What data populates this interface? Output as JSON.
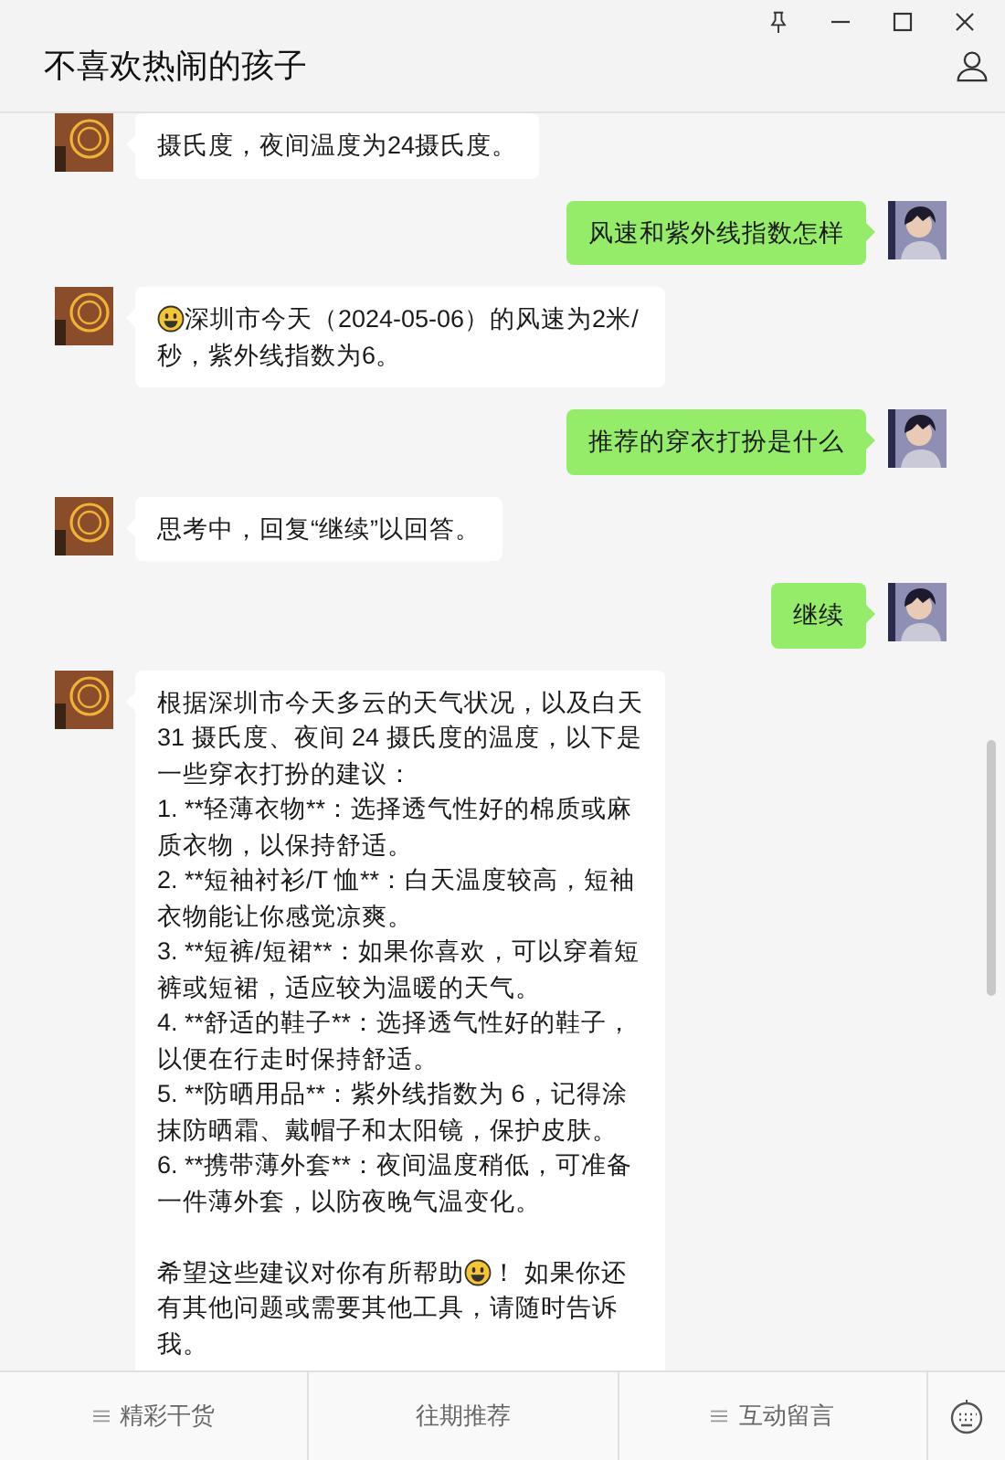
{
  "window": {
    "title": "不喜欢热闹的孩子"
  },
  "messages": [
    {
      "kind": "incoming",
      "paragraphs": [
        {
          "kind": "text",
          "segments": [
            {
              "kind": "text",
              "text": "摄氏度，夜间温度为24摄氏度。"
            }
          ]
        }
      ]
    },
    {
      "kind": "outgoing",
      "paragraphs": [
        {
          "kind": "text",
          "segments": [
            {
              "kind": "text",
              "text": "风速和紫外线指数怎样"
            }
          ]
        }
      ]
    },
    {
      "kind": "incoming",
      "paragraphs": [
        {
          "kind": "text",
          "segments": [
            {
              "kind": "emoji"
            },
            {
              "kind": "text",
              "text": "深圳市今天（2024-05-06）的风速为2米/秒，紫外线指数为6。"
            }
          ]
        }
      ]
    },
    {
      "kind": "outgoing",
      "paragraphs": [
        {
          "kind": "text",
          "segments": [
            {
              "kind": "text",
              "text": "推荐的穿衣打扮是什么"
            }
          ]
        }
      ]
    },
    {
      "kind": "incoming",
      "paragraphs": [
        {
          "kind": "text",
          "segments": [
            {
              "kind": "text",
              "text": "思考中，回复“继续”以回答。"
            }
          ]
        }
      ]
    },
    {
      "kind": "outgoing",
      "paragraphs": [
        {
          "kind": "text",
          "segments": [
            {
              "kind": "text",
              "text": "继续"
            }
          ]
        }
      ]
    },
    {
      "kind": "incoming",
      "paragraphs": [
        {
          "kind": "text",
          "segments": [
            {
              "kind": "text",
              "text": "根据深圳市今天多云的天气状况，以及白天 31 摄氏度、夜间 24 摄氏度的温度，以下是一些穿衣打扮的建议："
            }
          ]
        },
        {
          "kind": "text",
          "segments": [
            {
              "kind": "text",
              "text": "1. **轻薄衣物**：选择透气性好的棉质或麻质衣物，以保持舒适。"
            }
          ]
        },
        {
          "kind": "text",
          "segments": [
            {
              "kind": "text",
              "text": "2. **短袖衬衫/T 恤**：白天温度较高，短袖衣物能让你感觉凉爽。"
            }
          ]
        },
        {
          "kind": "text",
          "segments": [
            {
              "kind": "text",
              "text": "3. **短裤/短裙**：如果你喜欢，可以穿着短裤或短裙，适应较为温暖的天气。"
            }
          ]
        },
        {
          "kind": "text",
          "segments": [
            {
              "kind": "text",
              "text": "4. **舒适的鞋子**：选择透气性好的鞋子，以便在行走时保持舒适。"
            }
          ]
        },
        {
          "kind": "text",
          "segments": [
            {
              "kind": "text",
              "text": "5. **防晒用品**：紫外线指数为 6，记得涂抹防晒霜、戴帽子和太阳镜，保护皮肤。"
            }
          ]
        },
        {
          "kind": "text",
          "segments": [
            {
              "kind": "text",
              "text": "6. **携带薄外套**：夜间温度稍低，可准备一件薄外套，以防夜晚气温变化。"
            }
          ]
        },
        {
          "kind": "spacer"
        },
        {
          "kind": "text",
          "segments": [
            {
              "kind": "text",
              "text": "希望这些建议对你有所帮助"
            },
            {
              "kind": "emoji"
            },
            {
              "kind": "text",
              "text": "！ 如果你还有其他问题或需要其他工具，请随时告诉我。"
            }
          ]
        }
      ]
    }
  ],
  "bottom_menu": [
    {
      "label": "精彩干货",
      "menu_icon": true
    },
    {
      "label": "往期推荐",
      "menu_icon": false
    },
    {
      "label": "互动留言",
      "menu_icon": true
    }
  ]
}
